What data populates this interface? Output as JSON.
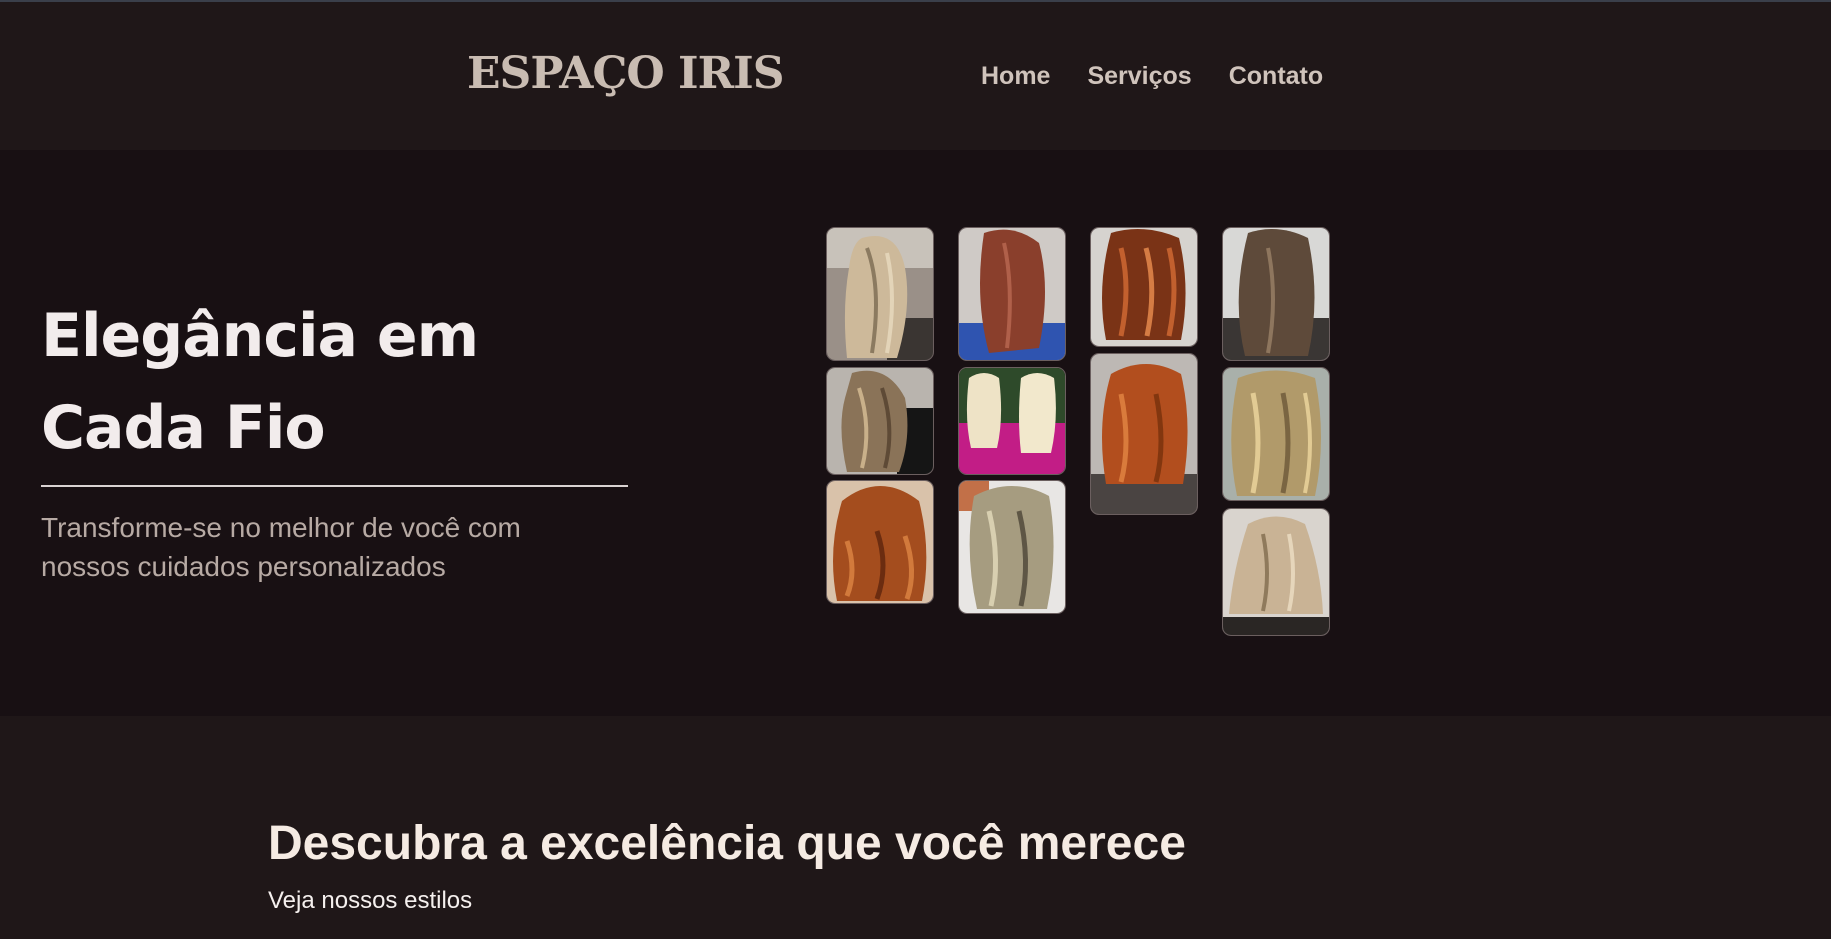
{
  "header": {
    "logo": "ESPAÇO IRIS",
    "nav": [
      "Home",
      "Serviços",
      "Contato"
    ]
  },
  "hero": {
    "title": "Elegância em Cada Fio",
    "subtitle": "Transforme-se no melhor de você com nossos cuidados personalizados"
  },
  "gallery": {
    "images": [
      "blonde-wavy-hair-photo",
      "auburn-straight-hair-photo",
      "copper-curly-hair-photo",
      "brown-wavy-hair-photo",
      "balayage-curly-hair-photo",
      "platinum-blonde-hair-photo",
      "copper-bob-hair-photo",
      "honey-blonde-wavy-hair-photo",
      "copper-curls-hair-photo",
      "ash-blonde-curly-hair-photo",
      "blonde-balayage-straight-hair-photo"
    ]
  },
  "section": {
    "title": "Descubra a excelência que você merece",
    "subtitle": "Veja nossos estilos"
  },
  "colors": {
    "header_bg": "#1f1718",
    "hero_bg": "#181013",
    "logo": "#c9bcb2",
    "nav_text": "#cfc3bb",
    "title_text": "#f2ecec",
    "subtitle_text": "#b7aaa4"
  }
}
